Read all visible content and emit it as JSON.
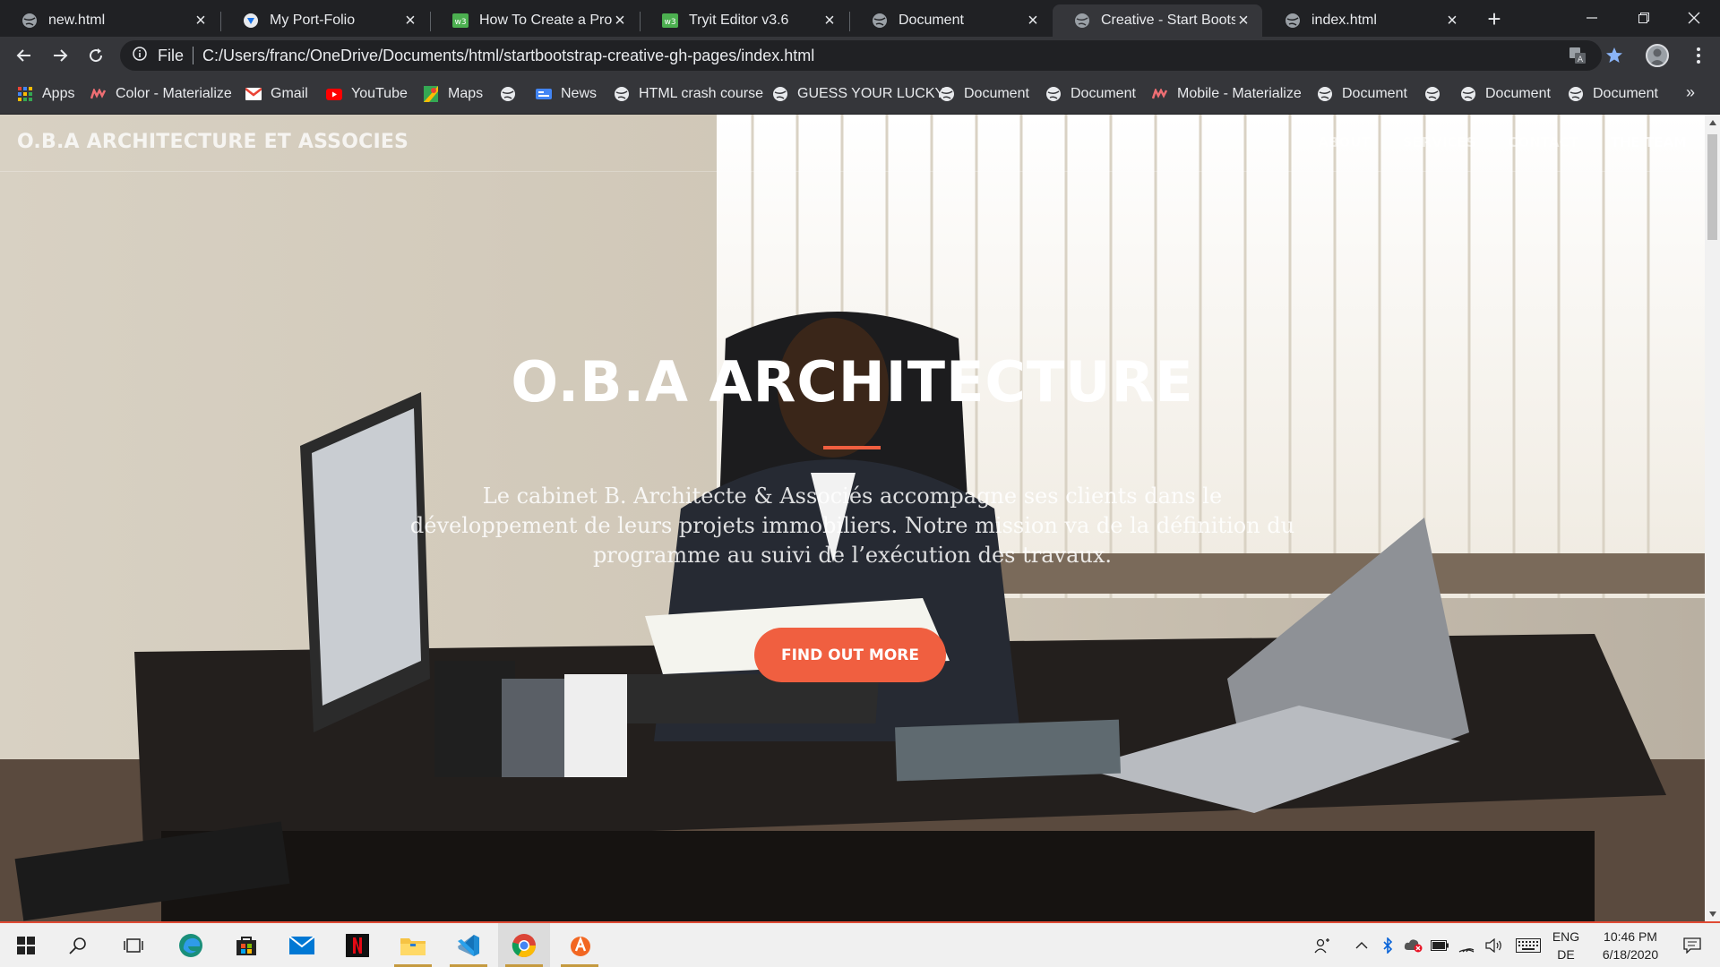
{
  "browser": {
    "tabs": [
      {
        "title": "new.html",
        "icon": "globe-icon"
      },
      {
        "title": "My Port-Folio",
        "icon": "site-logo-icon"
      },
      {
        "title": "How To Create a Profile",
        "icon": "w3-icon"
      },
      {
        "title": "Tryit Editor v3.6",
        "icon": "w3-icon"
      },
      {
        "title": "Document",
        "icon": "globe-icon"
      },
      {
        "title": "Creative - Start Bootstrap",
        "icon": "globe-icon"
      },
      {
        "title": "index.html",
        "icon": "globe-icon"
      }
    ],
    "active_tab": "Creative - Start Bootstrap",
    "address": {
      "scheme_label": "File",
      "url": "C:/Users/franc/OneDrive/Documents/html/startbootstrap-creative-gh-pages/index.html"
    },
    "bookmarks": [
      {
        "label": "Apps",
        "icon": "apps-grid-icon"
      },
      {
        "label": "Color - Materialize",
        "icon": "materialize-icon"
      },
      {
        "label": "Gmail",
        "icon": "gmail-icon"
      },
      {
        "label": "YouTube",
        "icon": "youtube-icon"
      },
      {
        "label": "Maps",
        "icon": "maps-icon"
      },
      {
        "label": "",
        "icon": "globe-icon"
      },
      {
        "label": "News",
        "icon": "news-icon"
      },
      {
        "label": "HTML crash course",
        "icon": "globe-icon"
      },
      {
        "label": "GUESS YOUR LUCKY",
        "icon": "globe-icon"
      },
      {
        "label": "Document",
        "icon": "globe-icon"
      },
      {
        "label": "Document",
        "icon": "globe-icon"
      },
      {
        "label": "Mobile - Materialize",
        "icon": "materialize-icon"
      },
      {
        "label": "Document",
        "icon": "globe-icon"
      },
      {
        "label": "",
        "icon": "globe-icon"
      },
      {
        "label": "Document",
        "icon": "globe-icon"
      },
      {
        "label": "Document",
        "icon": "globe-icon"
      }
    ],
    "more_bookmarks": "»"
  },
  "page": {
    "brand": "O.B.A ARCHITECTURE ET ASSOCIES",
    "nav": [
      "ABOUT",
      "SERVICES",
      "CONTACT",
      "THE TEAM"
    ],
    "hero_title": "O.B.A ARCHITECTURE",
    "hero_text": "Le cabinet B. Architecte & Associés accompagne ses clients dans le développement de leurs projets immobiliers. Notre mission va de la définition du programme au suivi de l’exécution des travaux.",
    "cta": "FIND OUT MORE",
    "colors": {
      "accent": "#f05f40"
    }
  },
  "taskbar": {
    "apps": [
      "start-icon",
      "search-icon",
      "task-view-icon",
      "edge-icon",
      "store-icon",
      "mail-icon",
      "netflix-icon",
      "file-explorer-icon",
      "vscode-icon",
      "chrome-icon",
      "avast-icon"
    ],
    "lang_top": "ENG",
    "lang_bottom": "DE",
    "time": "10:46 PM",
    "date": "6/18/2020"
  }
}
